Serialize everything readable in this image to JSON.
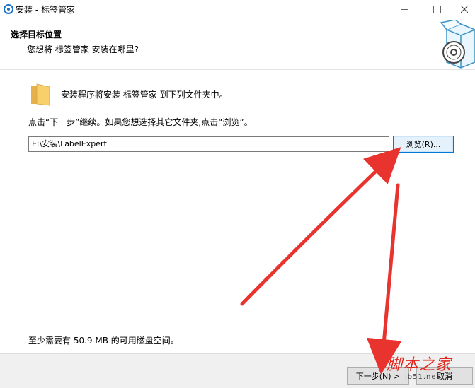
{
  "window": {
    "title": "安装 - 标签管家",
    "controls": {
      "minimize": "—",
      "maximize": "",
      "close": "✕"
    }
  },
  "header": {
    "heading": "选择目标位置",
    "subheading": "您想将 标签管家 安装在哪里?"
  },
  "body": {
    "install_text": "安装程序将安装 标签管家 到下列文件夹中。",
    "continue_text": "点击“下一步”继续。如果您想选择其它文件夹,点击“浏览”。",
    "path_value": "E:\\安装\\LabelExpert",
    "browse_label": "浏览(R)...",
    "space_text": "至少需要有 50.9 MB 的可用磁盘空间。"
  },
  "footer": {
    "next_label": "下一步(N) >",
    "cancel_label": "取消"
  },
  "watermark": {
    "main": "脚本之家",
    "sub": "jb51.net"
  },
  "colors": {
    "accent": "#0078d7",
    "arrow": "#e8332e"
  },
  "icons": {
    "app": "installer-icon",
    "folder": "folder-icon",
    "header": "package-disc-icon"
  }
}
